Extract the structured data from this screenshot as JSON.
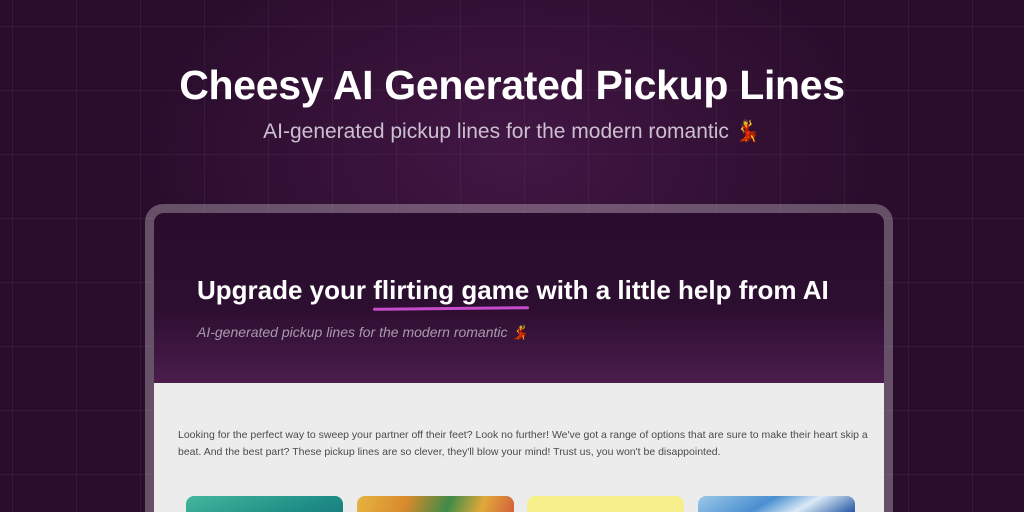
{
  "hero": {
    "title": "Cheesy AI Generated Pickup Lines",
    "subtitle": "AI-generated pickup lines for the modern romantic 💃"
  },
  "preview": {
    "headline_before": "Upgrade your ",
    "headline_highlight": "flirting game",
    "headline_after": " with a little help from AI",
    "tagline": "AI-generated pickup lines for the modern romantic 💃",
    "intro": "Looking for the perfect way to sweep your partner off their feet? Look no further! We've got a range of options that are sure to make their heart skip a beat. And the best part? These pickup lines are so clever, they'll blow your mind! Trust us, you won't be disappointed.",
    "cards": [
      {
        "name": "card-teal"
      },
      {
        "name": "card-food"
      },
      {
        "name": "card-yellow"
      },
      {
        "name": "card-blue"
      }
    ]
  },
  "colors": {
    "background": "#2a0d2d",
    "accent_underline": "#c54bc9",
    "content_background": "#ececec"
  }
}
